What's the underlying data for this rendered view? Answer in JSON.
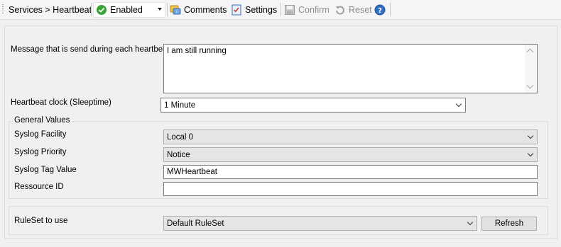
{
  "toolbar": {
    "breadcrumb": "Services > Heartbeat",
    "status_value": "Enabled",
    "comments_label": "Comments",
    "settings_label": "Settings",
    "confirm_label": "Confirm",
    "reset_label": "Reset",
    "icons": {
      "status": "check-circle-icon",
      "comments": "comments-icon",
      "settings": "settings-checklist-icon",
      "confirm": "save-disk-icon",
      "reset": "reset-icon",
      "help": "help-icon"
    }
  },
  "form": {
    "message_label": "Message that is send during each heartbeat",
    "message_value": "I am still running",
    "clock_label": "Heartbeat clock (Sleeptime)",
    "clock_value": "1 Minute",
    "general_values_label": "General Values",
    "facility_label": "Syslog Facility",
    "facility_value": "Local 0",
    "priority_label": "Syslog Priority",
    "priority_value": "Notice",
    "tag_label": "Syslog Tag Value",
    "tag_value": "MWHeartbeat",
    "resource_label": "Ressource ID",
    "resource_value": "",
    "ruleset_label": "RuleSet to use",
    "ruleset_value": "Default RuleSet",
    "refresh_label": "Refresh"
  },
  "colors": {
    "status_green": "#3aa335",
    "help_blue": "#2f6fc4",
    "disabled_text": "#8e8e8e"
  }
}
